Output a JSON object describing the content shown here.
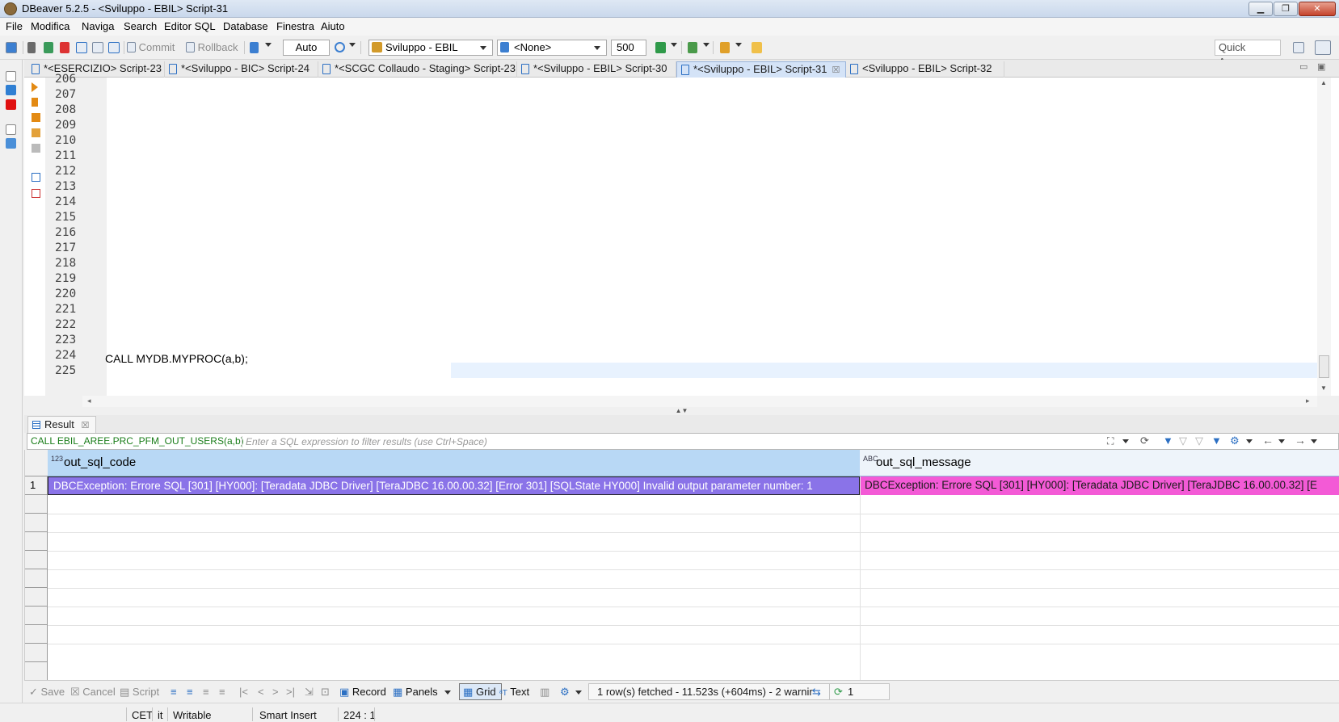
{
  "window": {
    "title": "DBeaver 5.2.5 - <Sviluppo - EBIL> Script-31",
    "colors": {
      "titlebar": "#c9d8ec",
      "active_tab": "#d4e3f7",
      "selected_cell": "#8a73e8",
      "message_cell": "#f35ad6",
      "column_header": "#b8d8f5"
    }
  },
  "menu": [
    "File",
    "Modifica",
    "Naviga",
    "Search",
    "Editor SQL",
    "Database",
    "Finestra",
    "Aiuto"
  ],
  "toolbar": {
    "commit": "Commit",
    "rollback": "Rollback",
    "transaction_mode": "Auto",
    "connection": "Sviluppo - EBIL",
    "schema": "<None>",
    "max_rows": "500",
    "quick_access": "Quick Access"
  },
  "tabs": [
    {
      "label": "*<ESERCIZIO> Script-23"
    },
    {
      "label": "*<Sviluppo - BIC> Script-24"
    },
    {
      "label": "*<SCGC Collaudo - Staging> Script-23"
    },
    {
      "label": "*<Sviluppo - EBIL> Script-30"
    },
    {
      "label": "*<Sviluppo - EBIL> Script-31",
      "close": "☒"
    },
    {
      "label": "<Sviluppo - EBIL> Script-32"
    }
  ],
  "editor": {
    "line_numbers": [
      "206",
      "207",
      "208",
      "209",
      "210",
      "211",
      "212",
      "213",
      "214",
      "215",
      "216",
      "217",
      "218",
      "219",
      "220",
      "221",
      "222",
      "223",
      "224",
      "225"
    ],
    "code_line": "CALL MYDB.MYPROC(a,b);"
  },
  "result": {
    "tab_label": "Result",
    "tab_close": "☒",
    "query": "CALL EBIL_AREE.PRC_PFM_OUT_USERS(a,b)",
    "filter_placeholder": "Enter a SQL expression to filter results (use Ctrl+Space)",
    "columns": [
      {
        "type_tag": "123",
        "name": "out_sql_code"
      },
      {
        "type_tag": "ABC",
        "name": "out_sql_message"
      }
    ],
    "rows": [
      {
        "num": "1",
        "out_sql_code": "DBCException: Errore SQL [301] [HY000]: [Teradata JDBC Driver] [TeraJDBC 16.00.00.32] [Error 301] [SQLState HY000] Invalid output parameter number: 1",
        "out_sql_message": "DBCException: Errore SQL [301] [HY000]: [Teradata JDBC Driver] [TeraJDBC 16.00.00.32] [E"
      }
    ]
  },
  "bottom": {
    "save": "Save",
    "cancel": "Cancel",
    "script": "Script",
    "record": "Record",
    "panels": "Panels",
    "grid": "Grid",
    "text": "Text",
    "status_message": "1 row(s) fetched - 11.523s (+604ms) - 2 warnir",
    "count": "1"
  },
  "statusbar": {
    "timezone": "CET",
    "locale": "it",
    "mode": "Writable",
    "insert_mode": "Smart Insert",
    "position": "224 : 1"
  }
}
